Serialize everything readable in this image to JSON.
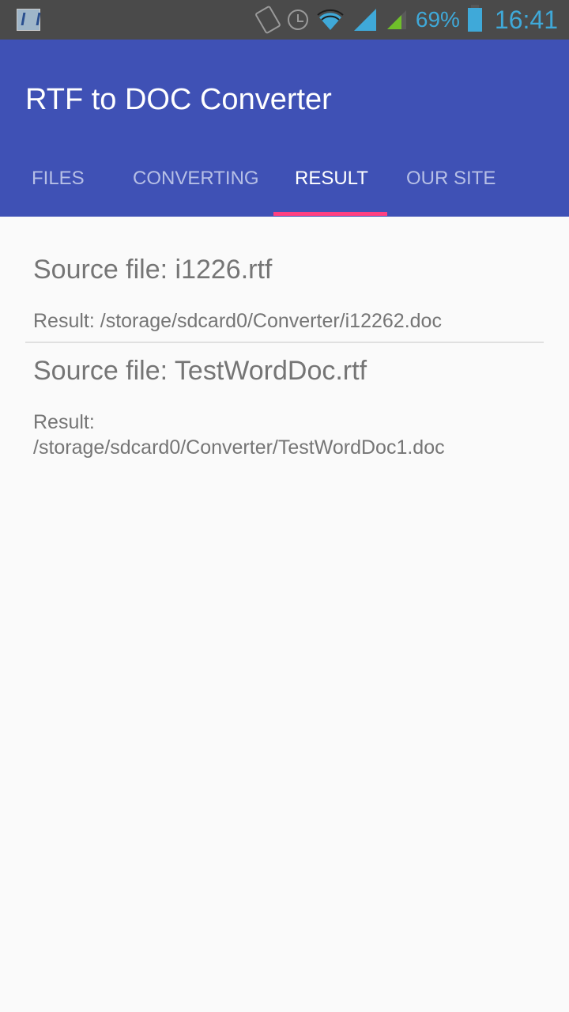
{
  "status_bar": {
    "icons": [
      "app-notification-icon",
      "vibrate-icon",
      "alarm-icon",
      "wifi-icon",
      "signal-icon-1",
      "signal-icon-2"
    ],
    "battery_percent": "69%",
    "time": "16:41"
  },
  "app": {
    "title": "RTF to DOC Converter",
    "accent_color": "#ff4081",
    "primary_color": "#3f51b5"
  },
  "tabs": [
    {
      "label": "FILES",
      "active": false
    },
    {
      "label": "CONVERTING",
      "active": false
    },
    {
      "label": "RESULT",
      "active": true
    },
    {
      "label": "OUR SITE",
      "active": false
    }
  ],
  "results": [
    {
      "source": "Source file: i1226.rtf",
      "result": "Result: /storage/sdcard0/Converter/i12262.doc"
    },
    {
      "source": "Source file: TestWordDoc.rtf",
      "result": "Result: /storage/sdcard0/Converter/TestWordDoc1.doc"
    }
  ]
}
